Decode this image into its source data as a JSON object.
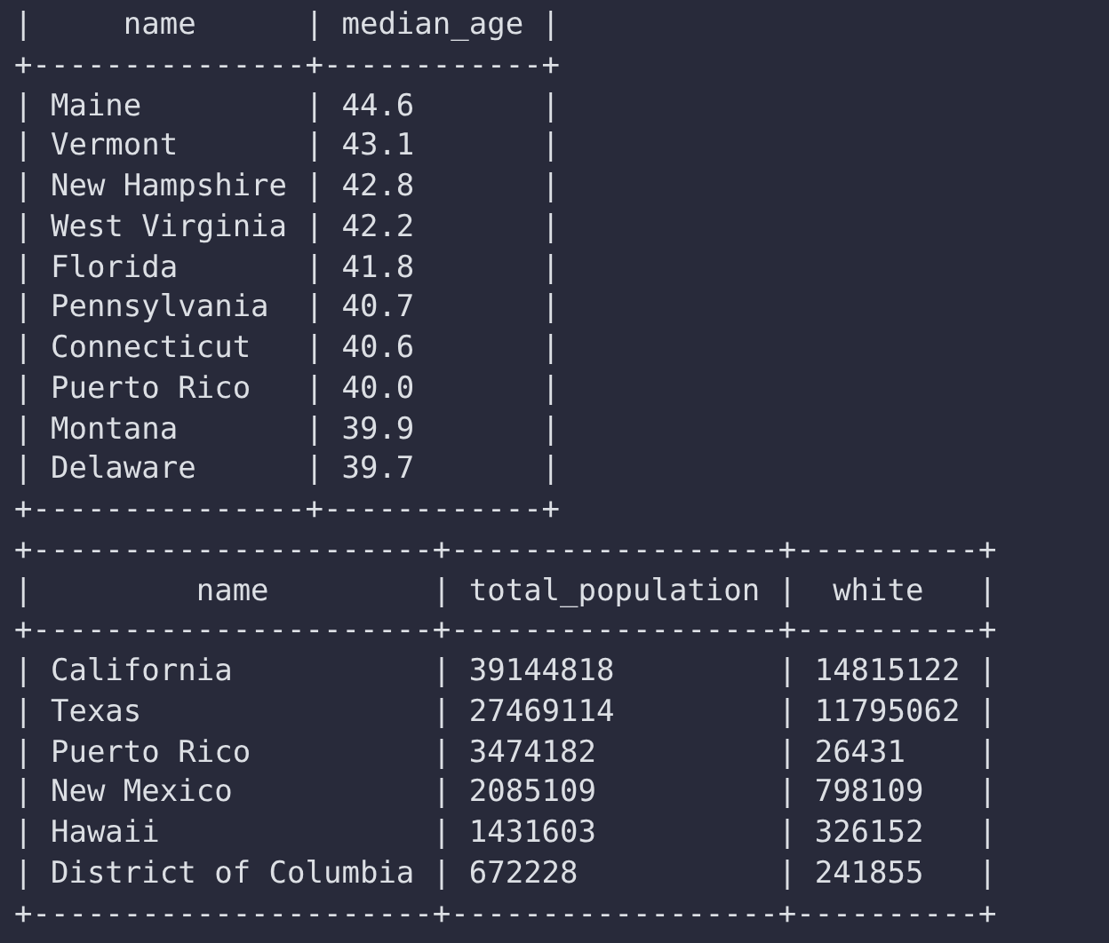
{
  "terminal": {
    "lines": [
      "|     name      | median_age |",
      "+---------------+------------+",
      "| Maine         | 44.6       |",
      "| Vermont       | 43.1       |",
      "| New Hampshire | 42.8       |",
      "| West Virginia | 42.2       |",
      "| Florida       | 41.8       |",
      "| Pennsylvania  | 40.7       |",
      "| Connecticut   | 40.6       |",
      "| Puerto Rico   | 40.0       |",
      "| Montana       | 39.9       |",
      "| Delaware      | 39.7       |",
      "+---------------+------------+",
      "+----------------------+------------------+----------+",
      "|         name         | total_population |  white   |",
      "+----------------------+------------------+----------+",
      "| California           | 39144818         | 14815122 |",
      "| Texas                | 27469114         | 11795062 |",
      "| Puerto Rico          | 3474182          | 26431    |",
      "| New Mexico           | 2085109          | 798109   |",
      "| Hawaii               | 1431603          | 326152   |",
      "| District of Columbia | 672228           | 241855   |",
      "+----------------------+------------------+----------+"
    ]
  }
}
